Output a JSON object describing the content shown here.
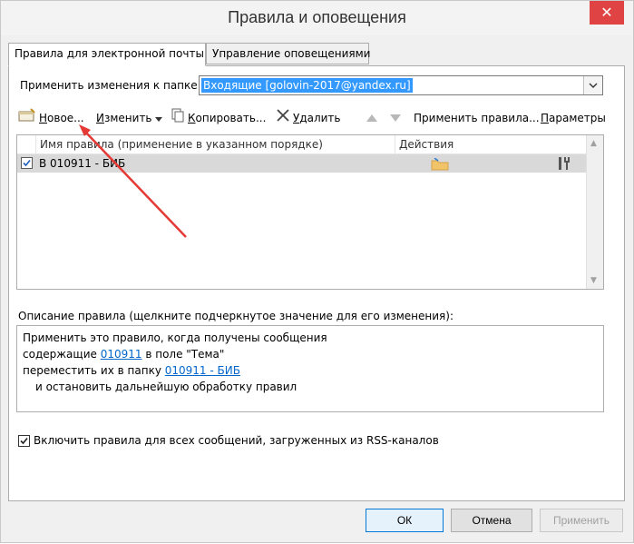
{
  "window": {
    "title": "Правила и оповещения",
    "close_glyph": "✕"
  },
  "tabs": [
    {
      "label": "Правила для электронной почты",
      "active": true
    },
    {
      "label": "Управление оповещениями",
      "active": false
    }
  ],
  "folder": {
    "label": "Применить изменения к папке:",
    "value": "Входящие [golovin-2017@yandex.ru]"
  },
  "toolbar": {
    "new": {
      "u": "Н",
      "rest": "овое..."
    },
    "edit": {
      "u": "И",
      "rest": "зменить"
    },
    "copy": {
      "u": "К",
      "rest": "опировать..."
    },
    "delete": {
      "u": "У",
      "rest": "далить"
    },
    "run": "Применить правила...",
    "options": {
      "u": "П",
      "rest": "араметры"
    }
  },
  "list": {
    "columns": [
      "Имя правила (применение в указанном порядке)",
      "Действия"
    ],
    "rows": [
      {
        "checked": true,
        "name": "В 010911 - БИБ"
      }
    ]
  },
  "description": {
    "label": "Описание правила (щелкните подчеркнутое значение для его изменения):",
    "line1": "Применить это правило, когда получены сообщения",
    "line2_pre": "содержащие ",
    "line2_link": "010911",
    "line2_post": " в поле \"Тема\"",
    "line3_pre": "переместить их в папку ",
    "line3_link": "010911 - БИБ",
    "line4": "и остановить дальнейшую обработку правил"
  },
  "rss_checkbox": {
    "checked": true,
    "label": "Включить правила для всех сообщений, загруженных из RSS-каналов"
  },
  "buttons": {
    "ok": "ОК",
    "cancel": "Отмена",
    "apply": "Применить"
  },
  "colors": {
    "selection": "#3399ff",
    "link": "#0066cc",
    "annotation_arrow": "#e53935",
    "close": "#e04343"
  }
}
